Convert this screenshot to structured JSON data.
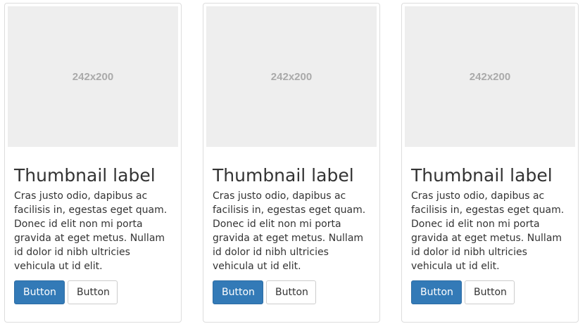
{
  "thumbnails": [
    {
      "image_text": "242x200",
      "label": "Thumbnail label",
      "text": "Cras justo odio, dapibus ac facilisis in, egestas eget quam. Donec id elit non mi porta gravida at eget metus. Nullam id dolor id nibh ultricies vehicula ut id elit.",
      "primary_button": "Button",
      "default_button": "Button"
    },
    {
      "image_text": "242x200",
      "label": "Thumbnail label",
      "text": "Cras justo odio, dapibus ac facilisis in, egestas eget quam. Donec id elit non mi porta gravida at eget metus. Nullam id dolor id nibh ultricies vehicula ut id elit.",
      "primary_button": "Button",
      "default_button": "Button"
    },
    {
      "image_text": "242x200",
      "label": "Thumbnail label",
      "text": "Cras justo odio, dapibus ac facilisis in, egestas eget quam. Donec id elit non mi porta gravida at eget metus. Nullam id dolor id nibh ultricies vehicula ut id elit.",
      "primary_button": "Button",
      "default_button": "Button"
    }
  ],
  "colors": {
    "primary": "#337ab7",
    "placeholder_bg": "#eeeeee",
    "placeholder_text": "#aaaaaa",
    "border": "#dddddd"
  }
}
